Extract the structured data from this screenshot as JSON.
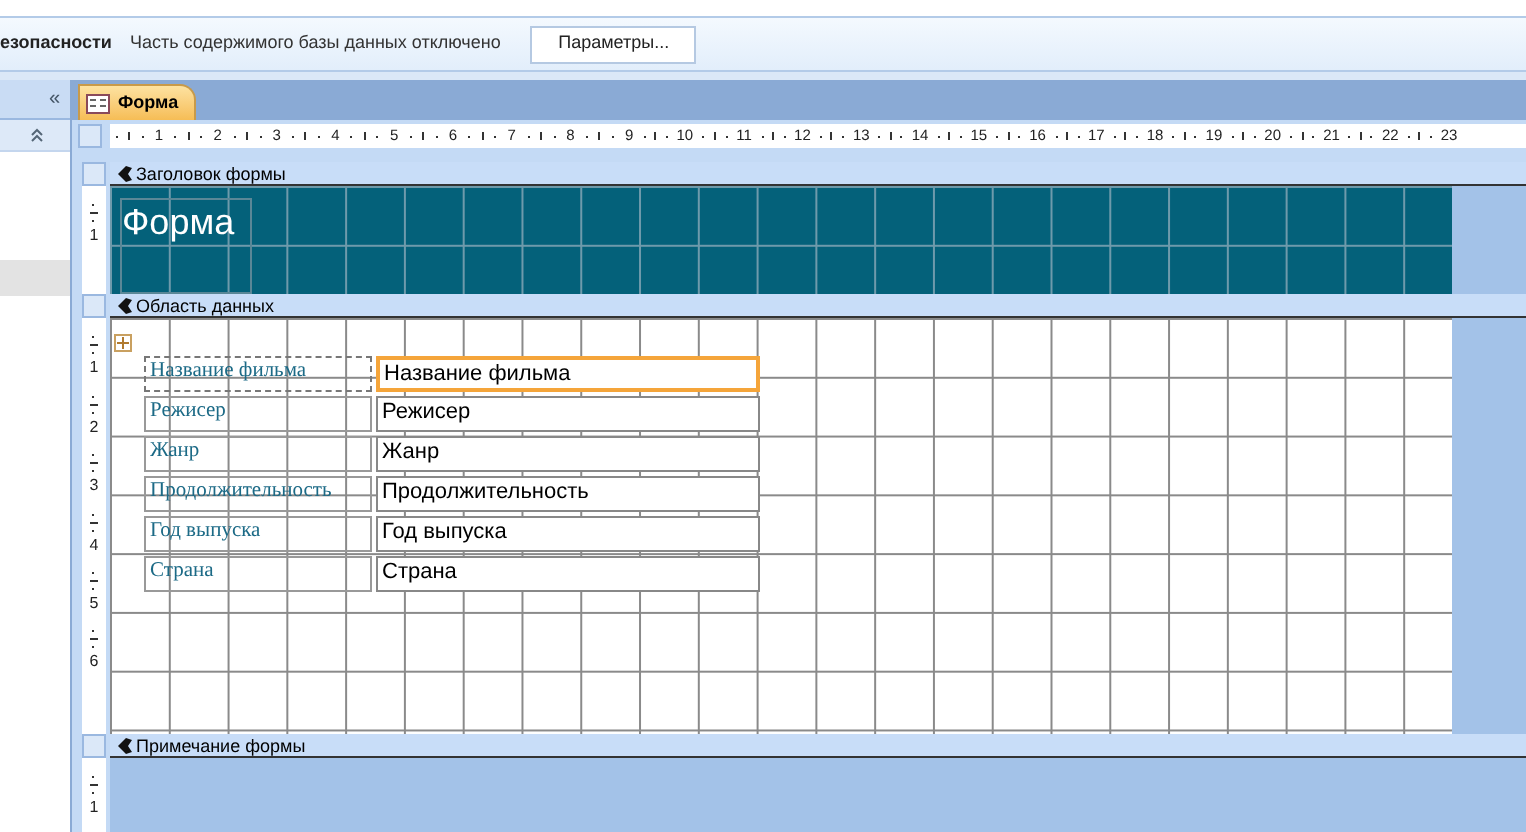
{
  "message_bar": {
    "title": "езопасности",
    "text": "Часть содержимого базы данных отключено",
    "button": "Параметры..."
  },
  "navigation_pane": {
    "collapse": "«"
  },
  "tabs": [
    {
      "label": "Форма",
      "selected": true
    }
  ],
  "ruler": {
    "numbers": [
      "1",
      "2",
      "3",
      "4",
      "5",
      "6",
      "7",
      "8",
      "9",
      "10",
      "11",
      "12",
      "13",
      "14",
      "15",
      "16",
      "17",
      "18",
      "19",
      "20",
      "21",
      "22",
      "23"
    ]
  },
  "sections": [
    {
      "kind": "header",
      "title": "Заголовок формы",
      "ruler": [
        "1"
      ],
      "heading": "Форма"
    },
    {
      "kind": "detail",
      "title": "Область данных",
      "ruler": [
        "1",
        "2",
        "3",
        "4",
        "5",
        "6"
      ],
      "fields": [
        {
          "label": "Название фильма",
          "value": "Название фильма",
          "selected": true
        },
        {
          "label": "Режисер",
          "value": "Режисер",
          "selected": false
        },
        {
          "label": "Жанр",
          "value": "Жанр",
          "selected": false
        },
        {
          "label": "Продолжительность",
          "value": "Продолжительность",
          "selected": false
        },
        {
          "label": "Год выпуска",
          "value": "Год выпуска",
          "selected": false
        },
        {
          "label": "Страна",
          "value": "Страна",
          "selected": false
        }
      ]
    },
    {
      "kind": "footer",
      "title": "Примечание формы",
      "ruler": [
        "1"
      ]
    }
  ]
}
